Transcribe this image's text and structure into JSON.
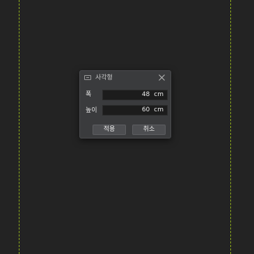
{
  "dialog": {
    "title": "사각형",
    "title_icon": "rectangle-icon",
    "close_icon": "close-icon"
  },
  "fields": {
    "width": {
      "label": "폭",
      "value": "48",
      "unit": "cm"
    },
    "height": {
      "label": "높이",
      "value": "60",
      "unit": "cm"
    }
  },
  "buttons": {
    "apply_label": "적용",
    "cancel_label": "취소"
  },
  "colors": {
    "background": "#232323",
    "guide": "#8fae1b",
    "dialog": "#3a3b3d",
    "field": "#1c1c1c",
    "button": "#4d4e51"
  }
}
